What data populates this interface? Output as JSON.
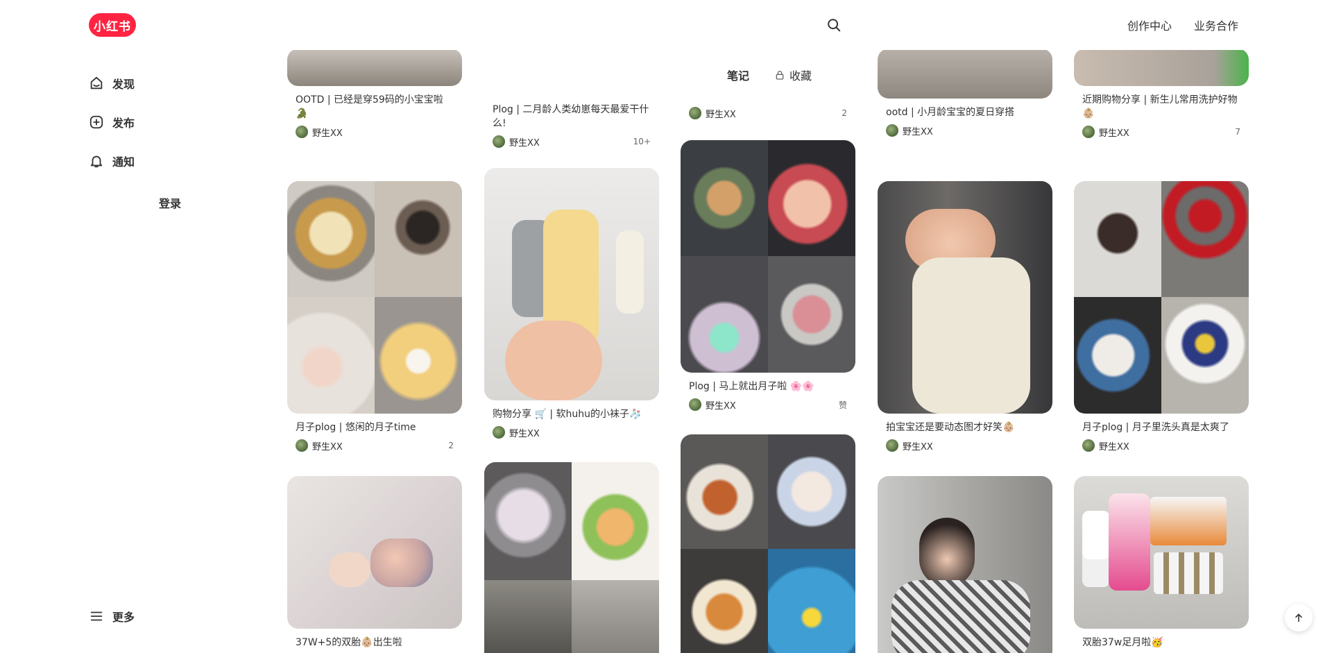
{
  "brand": {
    "logo_text": "小红书",
    "color": "#ff2442"
  },
  "header": {
    "links": [
      "创作中心",
      "业务合作"
    ]
  },
  "sidebar": {
    "items": [
      {
        "label": "发现",
        "icon": "home-icon"
      },
      {
        "label": "发布",
        "icon": "plus-icon"
      },
      {
        "label": "通知",
        "icon": "bell-icon"
      }
    ],
    "login_label": "登录",
    "more_label": "更多"
  },
  "tabs": [
    {
      "label": "笔记",
      "active": true
    },
    {
      "label": "收藏",
      "icon": "lock-icon",
      "active": false
    }
  ],
  "cards": [
    {
      "title": "OOTD | 已经是穿59码的小宝宝啦🐊",
      "author": "野生XX",
      "likes": ""
    },
    {
      "title": "Plog | 二月龄人类幼崽每天最爱干什么!",
      "author": "野生XX",
      "likes": "10+"
    },
    {
      "title": "",
      "author": "野生XX",
      "likes": "2"
    },
    {
      "title": "ootd | 小月龄宝宝的夏日穿搭",
      "author": "野生XX",
      "likes": ""
    },
    {
      "title": "近期购物分享 | 新生儿常用洗护好物👶🏼",
      "author": "野生XX",
      "likes": "7"
    },
    {
      "title": "月子plog | 悠闲的月子time",
      "author": "野生XX",
      "likes": "2"
    },
    {
      "title": "购物分享 🛒 | 软huhu的小袜子🧦",
      "author": "野生XX",
      "likes": ""
    },
    {
      "title": "Plog | 马上就出月子啦 🌸🌸",
      "author": "野生XX",
      "likes": "赞"
    },
    {
      "title": "拍宝宝还是要动态图才好笑👶🏼",
      "author": "野生XX",
      "likes": ""
    },
    {
      "title": "月子plog | 月子里洗头真是太爽了",
      "author": "野生XX",
      "likes": ""
    },
    {
      "title": "37W+5的双胎👶🏼出生啦",
      "author": "",
      "likes": ""
    },
    {
      "title": "",
      "author": "",
      "likes": ""
    },
    {
      "title": "",
      "author": "",
      "likes": ""
    },
    {
      "title": "",
      "author": "",
      "likes": ""
    },
    {
      "title": "双胎37w足月啦🥳",
      "author": "",
      "likes": ""
    }
  ]
}
